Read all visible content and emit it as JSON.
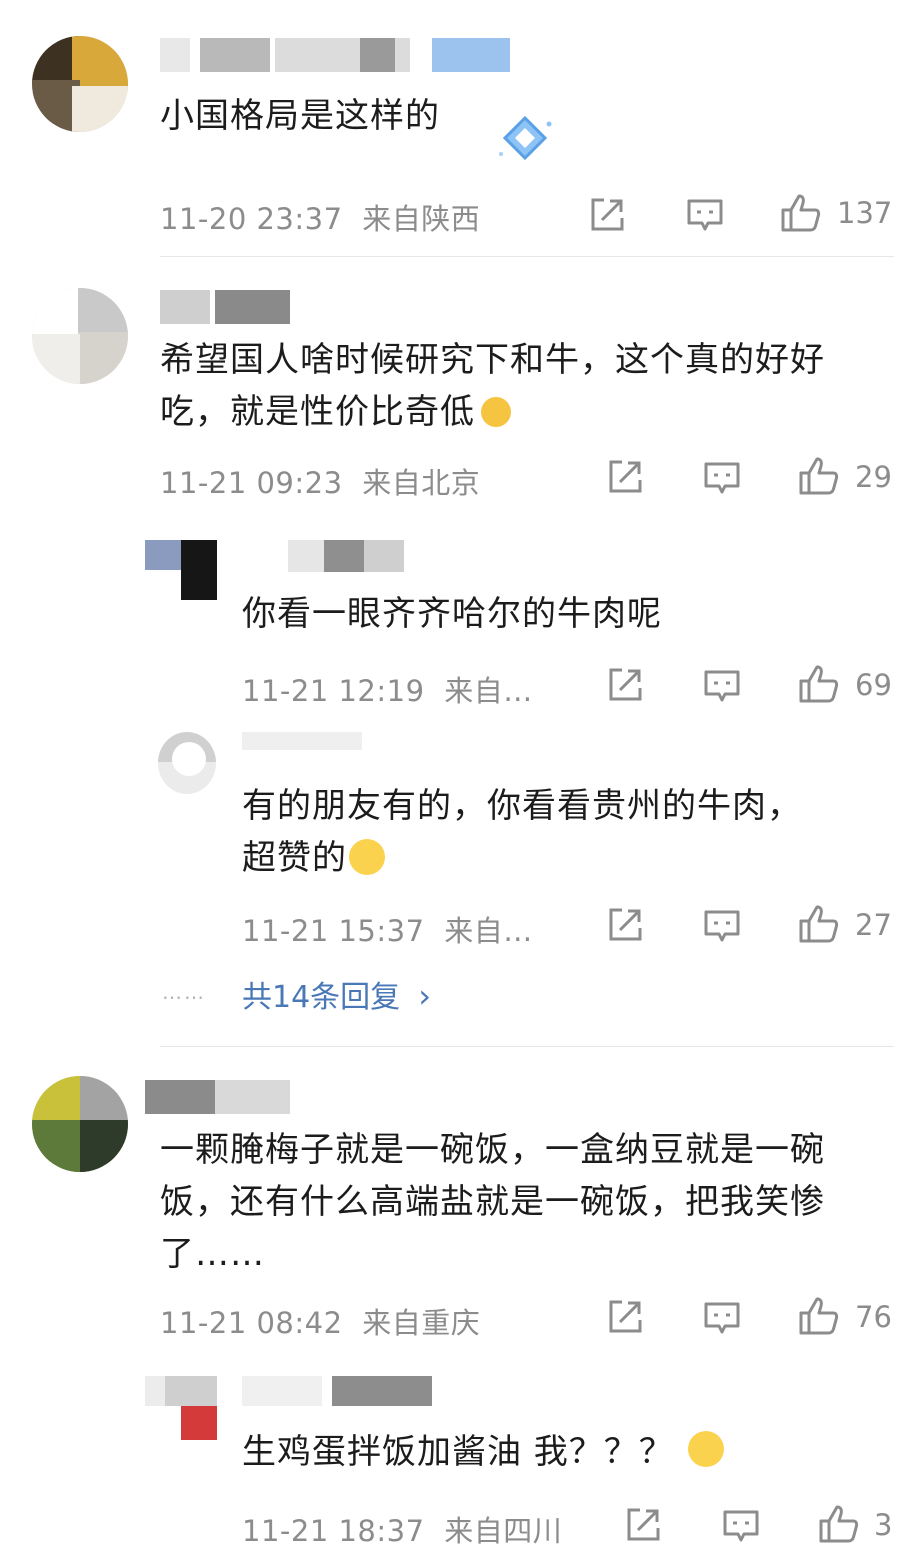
{
  "comments": [
    {
      "text_lines": [
        "小国格局是这样的"
      ],
      "time": "11-20 23:37",
      "location": "来自陕西",
      "likes": "137"
    },
    {
      "text_lines": [
        "希望国人啥时候研究下和牛，这个真的好好",
        "吃，就是性价比奇低"
      ],
      "time": "11-21 09:23",
      "location": "来自北京",
      "likes": "29",
      "replies": [
        {
          "text_lines": [
            "你看一眼齐齐哈尔的牛肉呢"
          ],
          "time": "11-21 12:19",
          "location": "来自…",
          "likes": "69"
        },
        {
          "text_lines": [
            "有的朋友有的，你看看贵州的牛肉，",
            "超赞的"
          ],
          "time": "11-21 15:37",
          "location": "来自…",
          "likes": "27"
        }
      ],
      "more_replies": "共14条回复",
      "more_chevron": "›",
      "dots": "……"
    },
    {
      "text_lines": [
        "一颗腌梅子就是一碗饭，一盒纳豆就是一碗",
        "饭，还有什么高端盐就是一碗饭，把我笑惨",
        "了……"
      ],
      "time": "11-21 08:42",
      "location": "来自重庆",
      "likes": "76",
      "replies": [
        {
          "text_lines": [
            "生鸡蛋拌饭加酱油 我？？？"
          ],
          "time": "11-21 18:37",
          "location": "来自四川",
          "likes": "3"
        }
      ]
    }
  ],
  "icons": {
    "share": "share-icon",
    "comment": "comment-icon",
    "like": "thumbs-up-icon"
  },
  "colors": {
    "meta_gray": "#8c8c8c",
    "link_blue": "#4a78b7",
    "text": "#1c1c1c"
  }
}
